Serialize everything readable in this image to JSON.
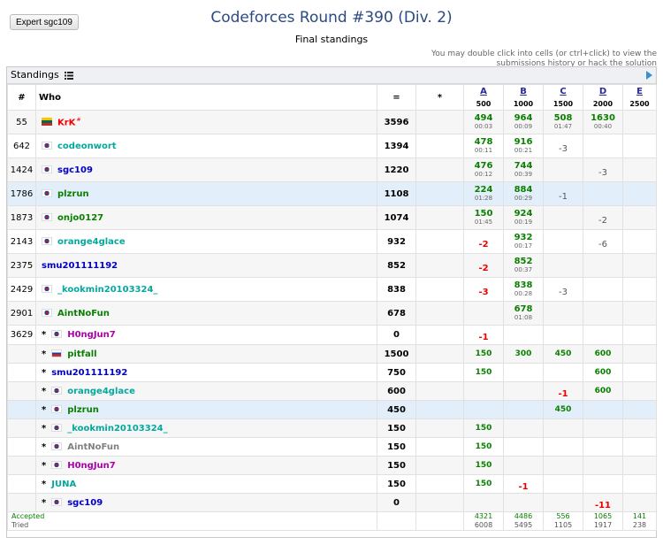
{
  "expert_button": "Expert sgc109",
  "title": "Codeforces Round #390 (Div. 2)",
  "subtitle": "Final standings",
  "hint": "You may double click into cells (or ctrl+click) to view the submissions history or hack the solution",
  "panel_title": "Standings",
  "headers": {
    "rank": "#",
    "who": "Who",
    "points": "=",
    "hacks": "*"
  },
  "problems": [
    {
      "letter": "A",
      "score": "500"
    },
    {
      "letter": "B",
      "score": "1000"
    },
    {
      "letter": "C",
      "score": "1500"
    },
    {
      "letter": "D",
      "score": "2000"
    },
    {
      "letter": "E",
      "score": "2500"
    }
  ],
  "rows": [
    {
      "rank": "55",
      "flag": "lt",
      "star": "",
      "handle": "KrK",
      "color": "red",
      "sup": "#",
      "points": "3596",
      "hl": false,
      "cells": [
        {
          "t": "acc",
          "v": "494",
          "time": "00:03"
        },
        {
          "t": "acc",
          "v": "964",
          "time": "00:09"
        },
        {
          "t": "acc",
          "v": "508",
          "time": "01:47"
        },
        {
          "t": "acc",
          "v": "1630",
          "time": "00:40"
        },
        {
          "t": "",
          "v": ""
        }
      ]
    },
    {
      "rank": "642",
      "flag": "kr",
      "star": "",
      "handle": "codeonwort",
      "color": "teal",
      "points": "1394",
      "hl": false,
      "cells": [
        {
          "t": "acc",
          "v": "478",
          "time": "00:11"
        },
        {
          "t": "acc",
          "v": "916",
          "time": "00:21"
        },
        {
          "t": "neg",
          "v": "-3"
        },
        {
          "t": "",
          "v": ""
        },
        {
          "t": "",
          "v": ""
        }
      ]
    },
    {
      "rank": "1424",
      "flag": "kr",
      "star": "",
      "handle": "sgc109",
      "color": "blue",
      "points": "1220",
      "hl": false,
      "cells": [
        {
          "t": "acc",
          "v": "476",
          "time": "00:12"
        },
        {
          "t": "acc",
          "v": "744",
          "time": "00:39"
        },
        {
          "t": "",
          "v": ""
        },
        {
          "t": "neg",
          "v": "-3"
        },
        {
          "t": "",
          "v": ""
        }
      ]
    },
    {
      "rank": "1786",
      "flag": "kr",
      "star": "",
      "handle": "plzrun",
      "color": "green",
      "points": "1108",
      "hl": true,
      "cells": [
        {
          "t": "acc",
          "v": "224",
          "time": "01:28"
        },
        {
          "t": "acc",
          "v": "884",
          "time": "00:29"
        },
        {
          "t": "neg",
          "v": "-1"
        },
        {
          "t": "",
          "v": ""
        },
        {
          "t": "",
          "v": ""
        }
      ]
    },
    {
      "rank": "1873",
      "flag": "kr",
      "star": "",
      "handle": "onjo0127",
      "color": "green",
      "points": "1074",
      "hl": false,
      "cells": [
        {
          "t": "acc",
          "v": "150",
          "time": "01:45"
        },
        {
          "t": "acc",
          "v": "924",
          "time": "00:19"
        },
        {
          "t": "",
          "v": ""
        },
        {
          "t": "neg",
          "v": "-2"
        },
        {
          "t": "",
          "v": ""
        }
      ]
    },
    {
      "rank": "2143",
      "flag": "kr",
      "star": "",
      "handle": "orange4glace",
      "color": "teal",
      "points": "932",
      "hl": false,
      "cells": [
        {
          "t": "rej",
          "v": "-2"
        },
        {
          "t": "acc",
          "v": "932",
          "time": "00:17"
        },
        {
          "t": "",
          "v": ""
        },
        {
          "t": "neg",
          "v": "-6"
        },
        {
          "t": "",
          "v": ""
        }
      ]
    },
    {
      "rank": "2375",
      "flag": "",
      "star": "",
      "handle": "smu201111192",
      "color": "blue",
      "points": "852",
      "hl": false,
      "cells": [
        {
          "t": "rej",
          "v": "-2"
        },
        {
          "t": "acc",
          "v": "852",
          "time": "00:37"
        },
        {
          "t": "",
          "v": ""
        },
        {
          "t": "",
          "v": ""
        },
        {
          "t": "",
          "v": ""
        }
      ]
    },
    {
      "rank": "2429",
      "flag": "kr",
      "star": "",
      "handle": "_kookmin20103324_",
      "color": "teal",
      "points": "838",
      "hl": false,
      "cells": [
        {
          "t": "rej",
          "v": "-3"
        },
        {
          "t": "acc",
          "v": "838",
          "time": "00:28"
        },
        {
          "t": "neg",
          "v": "-3"
        },
        {
          "t": "",
          "v": ""
        },
        {
          "t": "",
          "v": ""
        }
      ]
    },
    {
      "rank": "2901",
      "flag": "kr",
      "star": "",
      "handle": "AintNoFun",
      "color": "green",
      "points": "678",
      "hl": false,
      "cells": [
        {
          "t": "",
          "v": ""
        },
        {
          "t": "acc",
          "v": "678",
          "time": "01:08"
        },
        {
          "t": "",
          "v": ""
        },
        {
          "t": "",
          "v": ""
        },
        {
          "t": "",
          "v": ""
        }
      ]
    },
    {
      "rank": "3629",
      "flag": "kr",
      "star": "*",
      "handle": "H0ngJun7",
      "color": "violet",
      "points": "0",
      "hl": false,
      "cells": [
        {
          "t": "rej",
          "v": "-1"
        },
        {
          "t": "",
          "v": ""
        },
        {
          "t": "",
          "v": ""
        },
        {
          "t": "",
          "v": ""
        },
        {
          "t": "",
          "v": ""
        }
      ]
    },
    {
      "rank": "",
      "flag": "ru",
      "star": "*",
      "handle": "pitfall",
      "color": "green",
      "points": "1500",
      "hl": false,
      "cells": [
        {
          "t": "accs",
          "v": "150"
        },
        {
          "t": "accs",
          "v": "300"
        },
        {
          "t": "accs",
          "v": "450"
        },
        {
          "t": "accs",
          "v": "600"
        },
        {
          "t": "",
          "v": ""
        }
      ]
    },
    {
      "rank": "",
      "flag": "",
      "star": "*",
      "handle": "smu201111192",
      "color": "blue",
      "points": "750",
      "hl": false,
      "cells": [
        {
          "t": "accs",
          "v": "150"
        },
        {
          "t": "",
          "v": ""
        },
        {
          "t": "",
          "v": ""
        },
        {
          "t": "accs",
          "v": "600"
        },
        {
          "t": "",
          "v": ""
        }
      ]
    },
    {
      "rank": "",
      "flag": "kr",
      "star": "*",
      "handle": "orange4glace",
      "color": "teal",
      "points": "600",
      "hl": false,
      "cells": [
        {
          "t": "",
          "v": ""
        },
        {
          "t": "",
          "v": ""
        },
        {
          "t": "rej",
          "v": "-1"
        },
        {
          "t": "accs",
          "v": "600"
        },
        {
          "t": "",
          "v": ""
        }
      ]
    },
    {
      "rank": "",
      "flag": "kr",
      "star": "*",
      "handle": "plzrun",
      "color": "green",
      "points": "450",
      "hl": true,
      "cells": [
        {
          "t": "",
          "v": ""
        },
        {
          "t": "",
          "v": ""
        },
        {
          "t": "accs",
          "v": "450"
        },
        {
          "t": "",
          "v": ""
        },
        {
          "t": "",
          "v": ""
        }
      ]
    },
    {
      "rank": "",
      "flag": "kr",
      "star": "*",
      "handle": "_kookmin20103324_",
      "color": "teal",
      "points": "150",
      "hl": false,
      "cells": [
        {
          "t": "accs",
          "v": "150"
        },
        {
          "t": "",
          "v": ""
        },
        {
          "t": "",
          "v": ""
        },
        {
          "t": "",
          "v": ""
        },
        {
          "t": "",
          "v": ""
        }
      ]
    },
    {
      "rank": "",
      "flag": "kr",
      "star": "*",
      "handle": "AintNoFun",
      "color": "gray",
      "points": "150",
      "hl": false,
      "cells": [
        {
          "t": "accs",
          "v": "150"
        },
        {
          "t": "",
          "v": ""
        },
        {
          "t": "",
          "v": ""
        },
        {
          "t": "",
          "v": ""
        },
        {
          "t": "",
          "v": ""
        }
      ]
    },
    {
      "rank": "",
      "flag": "kr",
      "star": "*",
      "handle": "H0ngJun7",
      "color": "violet",
      "points": "150",
      "hl": false,
      "cells": [
        {
          "t": "accs",
          "v": "150"
        },
        {
          "t": "",
          "v": ""
        },
        {
          "t": "",
          "v": ""
        },
        {
          "t": "",
          "v": ""
        },
        {
          "t": "",
          "v": ""
        }
      ]
    },
    {
      "rank": "",
      "flag": "",
      "star": "*",
      "handle": "JUNA",
      "color": "teal",
      "points": "150",
      "hl": false,
      "cells": [
        {
          "t": "accs",
          "v": "150"
        },
        {
          "t": "rej",
          "v": "-1"
        },
        {
          "t": "",
          "v": ""
        },
        {
          "t": "",
          "v": ""
        },
        {
          "t": "",
          "v": ""
        }
      ]
    },
    {
      "rank": "",
      "flag": "kr",
      "star": "*",
      "handle": "sgc109",
      "color": "blue",
      "points": "0",
      "hl": false,
      "cells": [
        {
          "t": "",
          "v": ""
        },
        {
          "t": "",
          "v": ""
        },
        {
          "t": "",
          "v": ""
        },
        {
          "t": "rej",
          "v": "-11"
        },
        {
          "t": "",
          "v": ""
        }
      ]
    }
  ],
  "footer": {
    "accepted_label": "Accepted",
    "tried_label": "Tried",
    "accepted": [
      "4321",
      "4486",
      "556",
      "1065",
      "141"
    ],
    "tried": [
      "6008",
      "5495",
      "1105",
      "1917",
      "238"
    ]
  },
  "colors": {
    "red": "#e00000",
    "green": "#0a8000",
    "teal": "#03a89e",
    "blue": "#0000cc",
    "violet": "#aa00aa",
    "gray": "#808080",
    "highlight": "#e2eef9"
  }
}
